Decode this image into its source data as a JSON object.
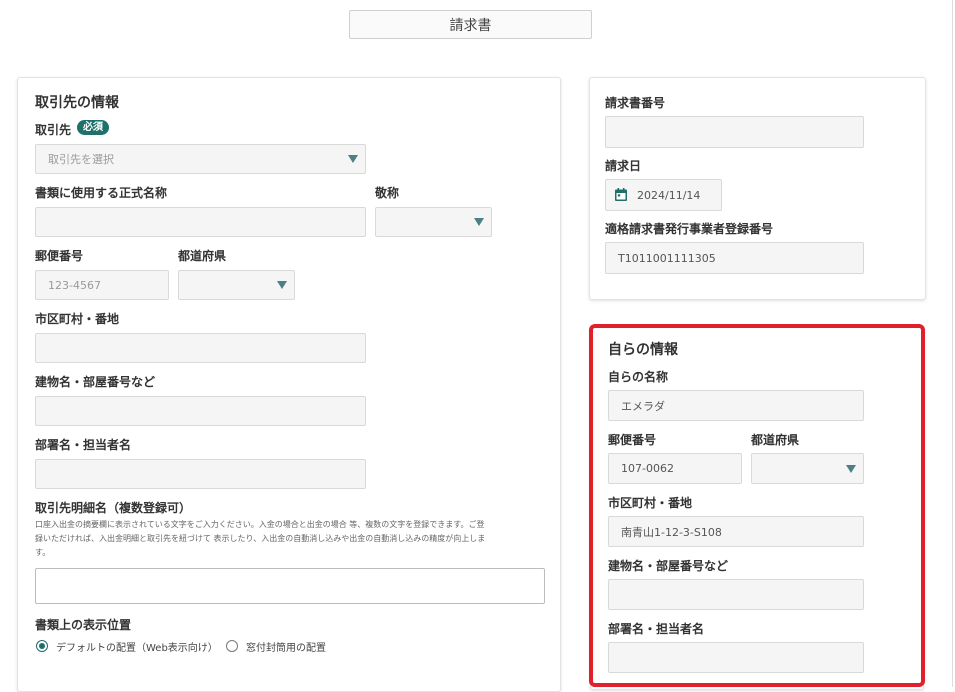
{
  "doc_type": "請求書",
  "client": {
    "section_title": "取引先の情報",
    "client_label": "取引先",
    "required_badge": "必須",
    "client_placeholder": "取引先を選択",
    "official_name_label": "書類に使用する正式名称",
    "honorific_label": "敬称",
    "postal_label": "郵便番号",
    "postal_placeholder": "123-4567",
    "prefecture_label": "都道府県",
    "city_label": "市区町村・番地",
    "building_label": "建物名・部屋番号など",
    "department_label": "部署名・担当者名",
    "detail_name_label": "取引先明細名（複数登録可）",
    "detail_help_1": "口座入出金の摘要欄に表示されている文字をご入力ください。入金の場合と出金の場合 等、複数の文字を登録できます。ご登",
    "detail_help_2": "録いただければ、入出金明細と取引先を紐づけて 表示したり、入出金の自動消し込みや出金の自動消し込みの精度が向上しま",
    "detail_help_3": "す。",
    "display_position_label": "書類上の表示位置",
    "option_default": "デフォルトの配置（Web表示向け）",
    "option_window": "窓付封筒用の配置"
  },
  "invoice": {
    "number_label": "請求書番号",
    "number_value": "",
    "date_label": "請求日",
    "date_value": "2024/11/14",
    "registration_label": "適格請求書発行事業者登録番号",
    "registration_value": "T1011001111305"
  },
  "own": {
    "section_title": "自らの情報",
    "name_label": "自らの名称",
    "name_value": "エメラダ",
    "postal_label": "郵便番号",
    "postal_value": "107-0062",
    "prefecture_label": "都道府県",
    "city_label": "市区町村・番地",
    "city_value": "南青山1-12-3-S108",
    "building_label": "建物名・部屋番号など",
    "department_label": "部署名・担当者名"
  },
  "colors": {
    "accent": "#1f6f6a",
    "highlight_border": "#e0202a",
    "arrow": "#4c7f86"
  }
}
